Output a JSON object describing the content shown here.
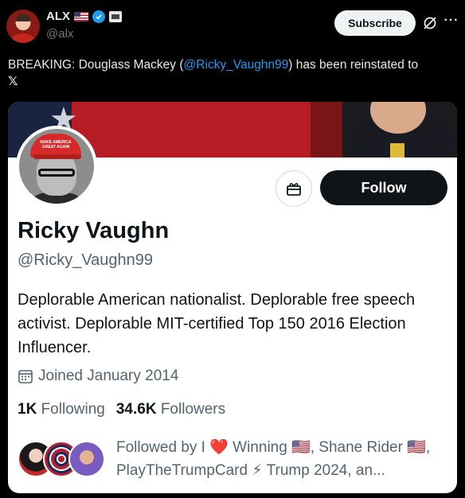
{
  "tweet": {
    "author_name": "ALX",
    "author_handle": "@alx",
    "subscribe_label": "Subscribe",
    "more_label": "···",
    "text_before": "BREAKING: Douglass Mackey (",
    "mention": "@Ricky_Vaughn99",
    "text_after": ") has been reinstated to ",
    "x_logo": "𝕏"
  },
  "profile": {
    "avatar_hat_text": "MAKE AMERICA GREAT AGAIN",
    "name": "Ricky Vaughn",
    "handle": "@Ricky_Vaughn99",
    "follow_label": "Follow",
    "bio": "Deplorable American nationalist. Deplorable free speech activist. Deplorable MIT-certified Top 150 2016 Election Influencer.",
    "joined": "Joined January 2014",
    "following_count": "1K",
    "following_label": "Following",
    "followers_count": "34.6K",
    "followers_label": "Followers",
    "followed_by": "Followed by I ❤️ Winning 🇺🇸, Shane Rider 🇺🇸, PlayTheTrumpCard ⚡ Trump 2024, an..."
  },
  "colors": {
    "accent": "#1d9bf0",
    "follow_button": "#0f1419",
    "background": "#000000"
  },
  "icons": [
    "verified-badge-icon",
    "us-flag-icon",
    "affiliate-badge-icon",
    "grok-icon",
    "more-icon",
    "gift-icon",
    "calendar-icon"
  ]
}
